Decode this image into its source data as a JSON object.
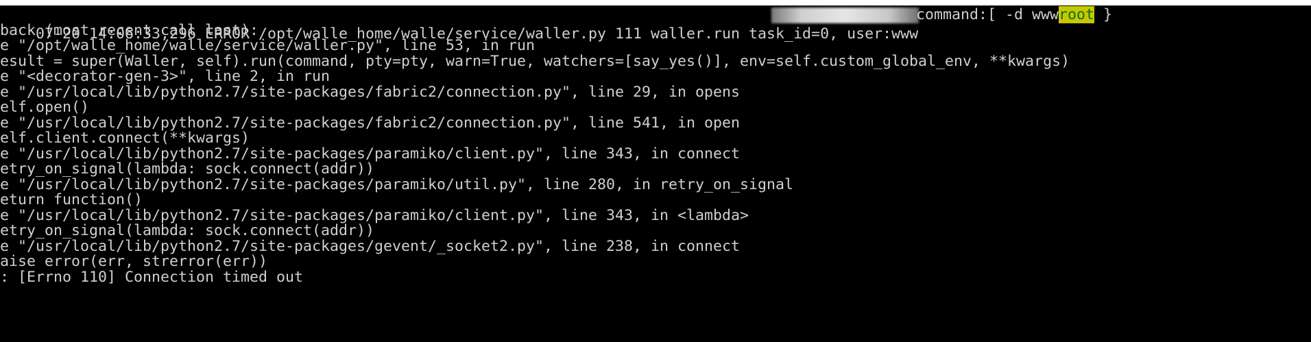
{
  "terminal": {
    "header_line": {
      "left_text": "07-20 14:06:33,296 ERROR /opt/walle_home/walle/service/waller.py 111 waller.run task_id=0, user:www",
      "right_text": "command:[ -d www",
      "highlight_text": "root",
      "trailing_text": " }"
    },
    "lines": [
      "back (most recent call last):",
      "e \"/opt/walle_home/walle/service/waller.py\", line 53, in run",
      "esult = super(Waller, self).run(command, pty=pty, warn=True, watchers=[say_yes()], env=self.custom_global_env, **kwargs)",
      "e \"<decorator-gen-3>\", line 2, in run",
      "e \"/usr/local/lib/python2.7/site-packages/fabric2/connection.py\", line 29, in opens",
      "elf.open()",
      "e \"/usr/local/lib/python2.7/site-packages/fabric2/connection.py\", line 541, in open",
      "elf.client.connect(**kwargs)",
      "e \"/usr/local/lib/python2.7/site-packages/paramiko/client.py\", line 343, in connect",
      "etry_on_signal(lambda: sock.connect(addr))",
      "e \"/usr/local/lib/python2.7/site-packages/paramiko/util.py\", line 280, in retry_on_signal",
      "eturn function()",
      "e \"/usr/local/lib/python2.7/site-packages/paramiko/client.py\", line 343, in <lambda>",
      "etry_on_signal(lambda: sock.connect(addr))",
      "e \"/usr/local/lib/python2.7/site-packages/gevent/_socket2.py\", line 238, in connect",
      "aise error(err, strerror(err))",
      ": [Errno 110] Connection timed out"
    ],
    "colors": {
      "background": "#000000",
      "text": "#d0d0d0",
      "highlight_bg": "#c8c800",
      "highlight_text": "#0a6e22"
    }
  }
}
